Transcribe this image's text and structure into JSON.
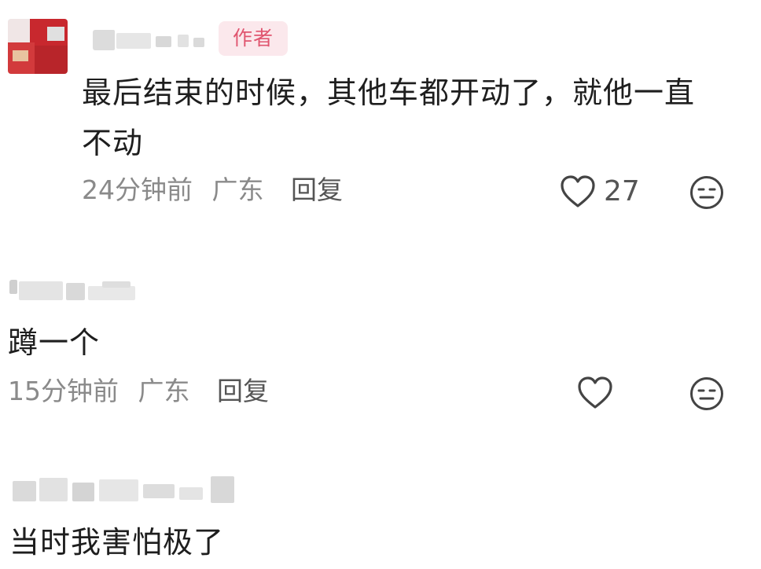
{
  "comments": [
    {
      "text_line1": "最后结束的时候，其他车都开动了，就他一直",
      "text_line2": "不动",
      "badge": "作者",
      "time": "24分钟前",
      "location": "广东",
      "reply_label": "回复",
      "like_count": "27",
      "icons": [
        "avatar",
        "heart-icon",
        "neutral-face-icon"
      ]
    },
    {
      "text_line1": "蹲一个",
      "time": "15分钟前",
      "location": "广东",
      "reply_label": "回复",
      "icons": [
        "heart-icon",
        "neutral-face-icon"
      ]
    },
    {
      "text_line1": "当时我害怕极了"
    }
  ],
  "colors": {
    "author_badge_bg": "#fbe8ec",
    "author_badge_text": "#e0556f",
    "meta_text": "#8a8a8a",
    "body_text": "#1e1e1e",
    "avatar_red": "#c8282e"
  }
}
